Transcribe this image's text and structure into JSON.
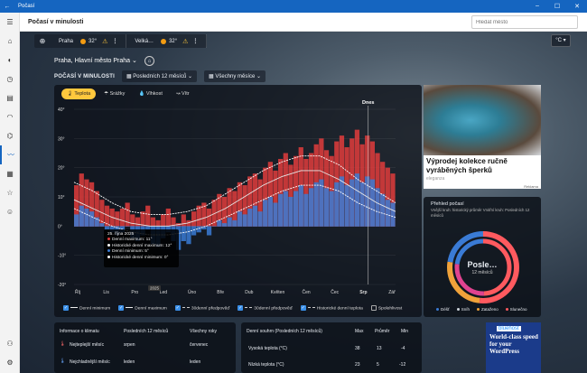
{
  "window": {
    "title": "Počasí",
    "min": "–",
    "max": "☐",
    "close": "✕"
  },
  "app": {
    "title": "Počasí v minulosti",
    "search_placeholder": "Hledat město"
  },
  "locations": [
    {
      "name": "Praha",
      "temp": "32°"
    },
    {
      "name": "Velká…",
      "temp": "32°"
    }
  ],
  "unit": "°C ▾",
  "place": "Praha, Hlavní město Praha ⌄",
  "history": {
    "title": "POČASÍ V MINULOSTI",
    "period": "▦  Posledních 12 měsíců  ⌄",
    "months": "▦  Všechny měsíce  ⌄"
  },
  "tabs": [
    "🌡 Teplota",
    "☂ Srážky",
    "💧 Vlhkost",
    "↝ Vítr"
  ],
  "chart_data": {
    "type": "area",
    "title": "",
    "today_label": "Dnes",
    "ylim": [
      -20,
      40
    ],
    "yticks": [
      "40°",
      "30°",
      "20°",
      "10°",
      "0°",
      "-10°",
      "-20°"
    ],
    "months": [
      "Říj",
      "Lis",
      "Pro",
      "Led",
      "Úno",
      "Bře",
      "Dub",
      "Květen",
      "Čen",
      "Čec",
      "Srp",
      "Zář"
    ],
    "year_marker": "2025",
    "series": [
      {
        "name": "Denní maximum",
        "color": "#e03c3c",
        "values": [
          14,
          18,
          16,
          15,
          12,
          9,
          7,
          6,
          5,
          6,
          8,
          4,
          3,
          5,
          7,
          3,
          2,
          4,
          6,
          3,
          1,
          4,
          2,
          5,
          7,
          8,
          6,
          9,
          11,
          10,
          13,
          12,
          15,
          14,
          17,
          18,
          16,
          20,
          22,
          19,
          23,
          25,
          21,
          24,
          27,
          23,
          25,
          28,
          30,
          26,
          24,
          29,
          31,
          27,
          30,
          33,
          28,
          31,
          29,
          25,
          22,
          20,
          18
        ]
      },
      {
        "name": "Denní minimum",
        "color": "#3a7bd5",
        "values": [
          4,
          7,
          6,
          5,
          3,
          1,
          -1,
          -2,
          -3,
          -2,
          0,
          -4,
          -5,
          -3,
          -1,
          -6,
          -7,
          -4,
          -2,
          -5,
          -8,
          -5,
          -6,
          -3,
          -2,
          -1,
          -3,
          0,
          2,
          1,
          3,
          2,
          5,
          4,
          6,
          7,
          5,
          9,
          10,
          8,
          11,
          12,
          10,
          12,
          14,
          11,
          13,
          15,
          16,
          13,
          12,
          15,
          17,
          14,
          16,
          18,
          15,
          17,
          16,
          13,
          11,
          9,
          8
        ]
      }
    ],
    "hist_max": [
      15,
      12,
      8,
      5,
      4,
      4,
      5,
      7,
      11,
      15,
      19,
      22,
      24,
      24,
      21,
      16,
      12,
      8
    ],
    "hist_min": [
      6,
      3,
      0,
      -2,
      -3,
      -3,
      -2,
      0,
      3,
      6,
      9,
      12,
      14,
      14,
      12,
      8,
      5,
      3
    ],
    "avg30": [
      9,
      6,
      3,
      1,
      0,
      0,
      1,
      3,
      6,
      10,
      14,
      17,
      19,
      19,
      16,
      12,
      8,
      5
    ]
  },
  "tooltip": {
    "date": "25. října 2025",
    "rows": [
      "Denní maximum: 11°",
      "Historické denní maximum: 12°",
      "Denní minimum: 5°",
      "Historické denní minimum: 0°"
    ]
  },
  "legend": [
    "Denní minimum",
    "Denní maximum",
    "30denní předpověď",
    "30denní předpověď",
    "Historické denní teplota",
    "Spolehlivost"
  ],
  "climate": {
    "title": "Informace o klimatu",
    "col1": "Posledních 12 měsíců",
    "col2": "Všechny roky",
    "rows": [
      {
        "label": "Nejteplejší měsíc",
        "v1": "srpen",
        "v2": "červenec"
      },
      {
        "label": "Nejchladnější měsíc",
        "v1": "leden",
        "v2": "leden"
      }
    ]
  },
  "summary": {
    "title": "Denní souhrn (Posledních 12 měsíců)",
    "cols": [
      "Max",
      "Průměr",
      "Min"
    ],
    "rows": [
      {
        "label": "Vysoká teplota (°C)",
        "max": "38",
        "avg": "13",
        "min": "-4"
      },
      {
        "label": "Nízká teplota (°C)",
        "max": "23",
        "avg": "5",
        "min": "-12"
      }
    ]
  },
  "ad1": {
    "headline": "Výprodej kolekce ručně vyráběných šperků",
    "source": "eleganza",
    "tag": "Reklama"
  },
  "overview": {
    "title": "Přehled počasí",
    "sub": "Vnější kruh: historický průměr    Vnitřní kruh: Posledních 12 měsíců",
    "center": "Posle…",
    "center_sub": "12 měsíců",
    "legend": [
      "Déšť",
      "Sníh",
      "Zataženo",
      "Slunečno"
    ],
    "legend_colors": [
      "#3a7bd5",
      "#cfd6dd",
      "#f0a23a",
      "#ff5a5f"
    ]
  },
  "ad2": {
    "brand": "bluehost",
    "headline": "World-class speed for your WordPress"
  },
  "sidebar_icons": [
    "home-icon",
    "forecast-icon",
    "history-icon",
    "news-icon",
    "maps-icon",
    "trend-icon",
    "monthly-icon",
    "favorites-icon",
    "life-icon",
    "account-icon",
    "settings-icon"
  ]
}
